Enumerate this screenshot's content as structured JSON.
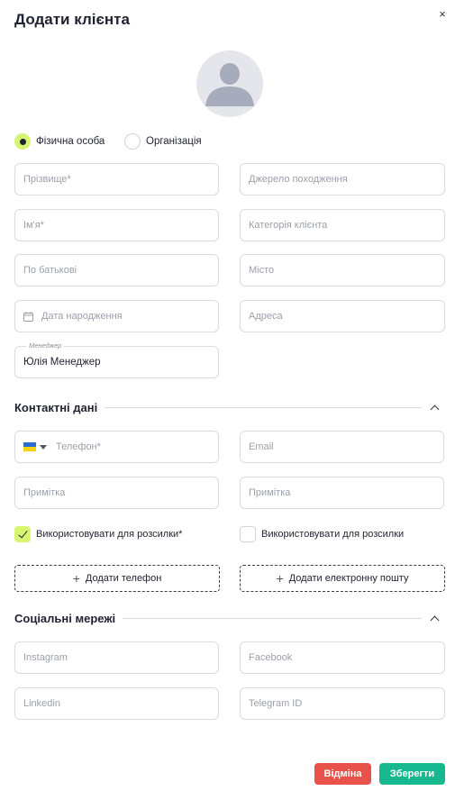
{
  "dialog": {
    "title": "Додати клієнта",
    "close_icon": "×"
  },
  "type_radio": {
    "person": "Фізична особа",
    "organization": "Організація"
  },
  "fields": {
    "last_name": "Прізвище*",
    "source": "Джерело походження",
    "first_name": "Ім'я*",
    "category": "Категорія клієнта",
    "patronymic": "По батькові",
    "city": "Місто",
    "birth_date": "Дата народження",
    "address": "Адреса",
    "manager_label": "Менеджер",
    "manager_value": "Юлія Менеджер"
  },
  "contacts": {
    "title": "Контактні дані",
    "phone": "Телефон*",
    "email": "Email",
    "phone_note": "Примітка",
    "email_note": "Примітка",
    "phone_mailing": "Використовувати для розсилки*",
    "email_mailing": "Використовувати для розсилки",
    "add_phone": "Додати телефон",
    "add_email": "Додати електронну пошту"
  },
  "social": {
    "title": "Соціальні мережі",
    "instagram": "Instagram",
    "facebook": "Facebook",
    "linkedin": "Linkedin",
    "telegram": "Telegram ID"
  },
  "actions": {
    "cancel": "Відміна",
    "save": "Зберегти"
  },
  "colors": {
    "accent": "#d8f572",
    "cancel": "#e8524a",
    "save": "#17b890",
    "flag_blue": "#2f6ad0",
    "flag_yellow": "#f5d20a"
  }
}
